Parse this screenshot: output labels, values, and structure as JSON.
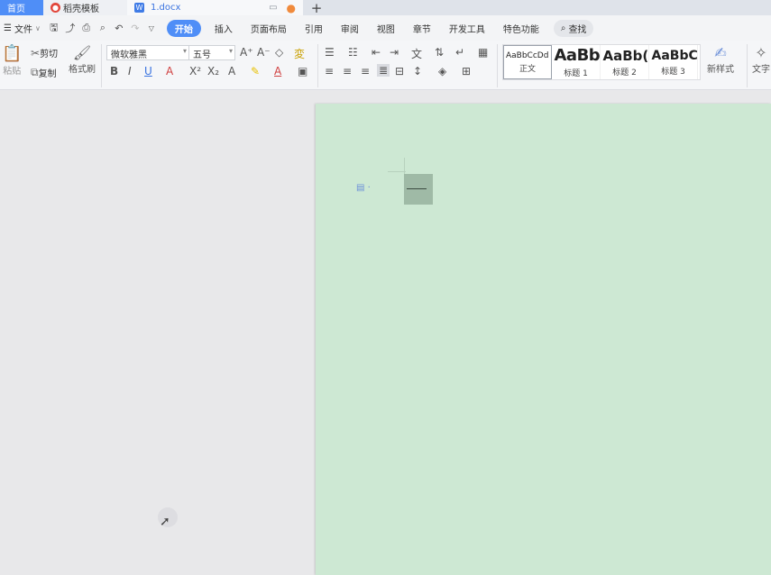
{
  "tabs": {
    "home": "首页",
    "template": "稻壳模板",
    "doc": "1.docx",
    "doc_icon_letter": "W",
    "new_tab": "+"
  },
  "menu": {
    "file": "文件",
    "items": [
      "开始",
      "插入",
      "页面布局",
      "引用",
      "审阅",
      "视图",
      "章节",
      "开发工具",
      "特色功能"
    ],
    "search": "查找"
  },
  "ribbon": {
    "paste": "粘贴",
    "cut": "剪切",
    "copy": "复制",
    "format_painter": "格式刷",
    "font_name": "微软雅黑",
    "font_size": "五号",
    "styles": [
      {
        "preview": "AaBbCcDd",
        "name": "正文"
      },
      {
        "preview": "AaBb",
        "name": "标题 1"
      },
      {
        "preview": "AaBb(",
        "name": "标题 2"
      },
      {
        "preview": "AaBbC",
        "name": "标题 3"
      }
    ],
    "new_style": "新样式",
    "text_tools": "文字"
  },
  "colors": {
    "accent": "#4f8ef7",
    "page_bg": "#cde8d3",
    "workspace_bg": "#e8e8ea"
  }
}
